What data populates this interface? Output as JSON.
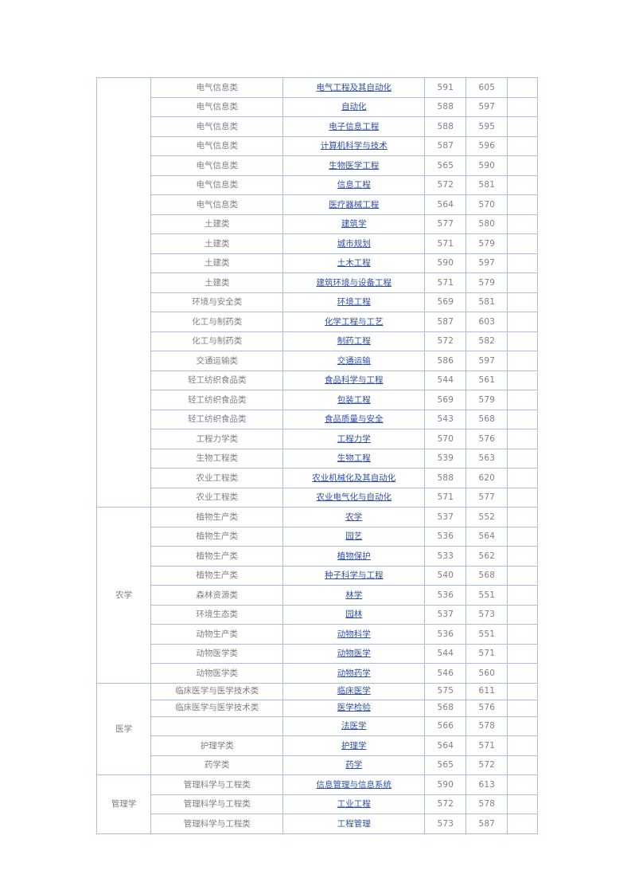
{
  "table": {
    "border_color": "#a9bee6",
    "link_color": "#2f4fae",
    "text_color": "#808080",
    "columns": [
      "discipline",
      "category",
      "major",
      "score_min",
      "score_max",
      "extra"
    ],
    "groups": [
      {
        "discipline": "",
        "rows": [
          {
            "category": "电气信息类",
            "major": "电气工程及其自动化",
            "link": true,
            "score_min": "591",
            "score_max": "605",
            "extra": "",
            "height": "std"
          },
          {
            "category": "电气信息类",
            "major": "自动化",
            "link": true,
            "score_min": "588",
            "score_max": "597",
            "extra": "",
            "height": "std"
          },
          {
            "category": "电气信息类",
            "major": "电子信息工程",
            "link": true,
            "score_min": "588",
            "score_max": "595",
            "extra": "",
            "height": "std"
          },
          {
            "category": "电气信息类",
            "major": "计算机科学与技术",
            "link": true,
            "score_min": "587",
            "score_max": "596",
            "extra": "",
            "height": "std"
          },
          {
            "category": "电气信息类",
            "major": "生物医学工程",
            "link": true,
            "score_min": "565",
            "score_max": "590",
            "extra": "",
            "height": "std"
          },
          {
            "category": "电气信息类",
            "major": "信息工程",
            "link": true,
            "score_min": "572",
            "score_max": "581",
            "extra": "",
            "height": "std"
          },
          {
            "category": "电气信息类",
            "major": "医疗器械工程",
            "link": true,
            "score_min": "564",
            "score_max": "570",
            "extra": "",
            "height": "std"
          },
          {
            "category": "土建类",
            "major": "建筑学",
            "link": true,
            "score_min": "577",
            "score_max": "580",
            "extra": "",
            "height": "std"
          },
          {
            "category": "土建类",
            "major": "城市规划",
            "link": true,
            "score_min": "571",
            "score_max": "579",
            "extra": "",
            "height": "std"
          },
          {
            "category": "土建类",
            "major": "土木工程",
            "link": true,
            "score_min": "590",
            "score_max": "597",
            "extra": "",
            "height": "std"
          },
          {
            "category": "土建类",
            "major": "建筑环境与设备工程",
            "link": true,
            "score_min": "571",
            "score_max": "579",
            "extra": "",
            "height": "std"
          },
          {
            "category": "环境与安全类",
            "major": "环境工程",
            "link": true,
            "score_min": "569",
            "score_max": "581",
            "extra": "",
            "height": "std"
          },
          {
            "category": "化工与制药类",
            "major": "化学工程与工艺",
            "link": true,
            "score_min": "587",
            "score_max": "603",
            "extra": "",
            "height": "std"
          },
          {
            "category": "化工与制药类",
            "major": "制药工程",
            "link": true,
            "score_min": "572",
            "score_max": "582",
            "extra": "",
            "height": "std"
          },
          {
            "category": "交通运输类",
            "major": "交通运输",
            "link": true,
            "score_min": "586",
            "score_max": "597",
            "extra": "",
            "height": "std"
          },
          {
            "category": "轻工纺织食品类",
            "major": "食品科学与工程",
            "link": true,
            "score_min": "544",
            "score_max": "561",
            "extra": "",
            "height": "std"
          },
          {
            "category": "轻工纺织食品类",
            "major": "包装工程",
            "link": true,
            "score_min": "569",
            "score_max": "579",
            "extra": "",
            "height": "std"
          },
          {
            "category": "轻工纺织食品类",
            "major": "食品质量与安全",
            "link": true,
            "score_min": "543",
            "score_max": "568",
            "extra": "",
            "height": "std"
          },
          {
            "category": "工程力学类",
            "major": "工程力学",
            "link": true,
            "score_min": "570",
            "score_max": "576",
            "extra": "",
            "height": "std"
          },
          {
            "category": "生物工程类",
            "major": "生物工程",
            "link": true,
            "score_min": "539",
            "score_max": "563",
            "extra": "",
            "height": "std"
          },
          {
            "category": "农业工程类",
            "major": "农业机械化及其自动化",
            "link": true,
            "score_min": "588",
            "score_max": "620",
            "extra": "",
            "height": "std"
          },
          {
            "category": "农业工程类",
            "major": "农业电气化与自动化",
            "link": true,
            "score_min": "571",
            "score_max": "577",
            "extra": "",
            "height": "std"
          }
        ]
      },
      {
        "discipline": "农学",
        "rows": [
          {
            "category": "植物生产类",
            "major": "农学",
            "link": true,
            "score_min": "537",
            "score_max": "552",
            "extra": "",
            "height": "std"
          },
          {
            "category": "植物生产类",
            "major": "园艺",
            "link": true,
            "score_min": "536",
            "score_max": "564",
            "extra": "",
            "height": "std"
          },
          {
            "category": "植物生产类",
            "major": "植物保护",
            "link": true,
            "score_min": "533",
            "score_max": "562",
            "extra": "",
            "height": "std"
          },
          {
            "category": "植物生产类",
            "major": "种子科学与工程",
            "link": true,
            "score_min": "540",
            "score_max": "568",
            "extra": "",
            "height": "std"
          },
          {
            "category": "森林资源类",
            "major": "林学",
            "link": true,
            "score_min": "536",
            "score_max": "551",
            "extra": "",
            "height": "std"
          },
          {
            "category": "环境生态类",
            "major": "园林",
            "link": true,
            "score_min": "537",
            "score_max": "573",
            "extra": "",
            "height": "std"
          },
          {
            "category": "动物生产类",
            "major": "动物科学",
            "link": true,
            "score_min": "536",
            "score_max": "551",
            "extra": "",
            "height": "std"
          },
          {
            "category": "动物医学类",
            "major": "动物医学",
            "link": true,
            "score_min": "544",
            "score_max": "571",
            "extra": "",
            "height": "std"
          },
          {
            "category": "动物医学类",
            "major": "动物药学",
            "link": true,
            "score_min": "546",
            "score_max": "560",
            "extra": "",
            "height": "std"
          }
        ]
      },
      {
        "discipline": "医学",
        "rows": [
          {
            "category": "临床医学与医学技术类",
            "major": "临床医学",
            "link": true,
            "score_min": "575",
            "score_max": "611",
            "extra": "",
            "height": "short"
          },
          {
            "category": "临床医学与医学技术类",
            "major": "医学检验",
            "link": true,
            "score_min": "568",
            "score_max": "576",
            "extra": "",
            "height": "short"
          },
          {
            "category": "",
            "major": "法医学",
            "link": true,
            "score_min": "566",
            "score_max": "578",
            "extra": "",
            "height": "std"
          },
          {
            "category": "护理学类",
            "major": "护理学",
            "link": true,
            "score_min": "564",
            "score_max": "571",
            "extra": "",
            "height": "std"
          },
          {
            "category": "药学类",
            "major": "药学",
            "link": true,
            "score_min": "565",
            "score_max": "572",
            "extra": "",
            "height": "std"
          }
        ]
      },
      {
        "discipline": "管理学",
        "rows": [
          {
            "category": "管理科学与工程类",
            "major": "信息管理与信息系统",
            "link": true,
            "score_min": "590",
            "score_max": "613",
            "extra": "",
            "height": "std"
          },
          {
            "category": "管理科学与工程类",
            "major": "工业工程",
            "link": true,
            "score_min": "572",
            "score_max": "578",
            "extra": "",
            "height": "std"
          },
          {
            "category": "管理科学与工程类",
            "major": "工程管理",
            "link": false,
            "score_min": "573",
            "score_max": "587",
            "extra": "",
            "height": "std"
          }
        ]
      }
    ]
  }
}
